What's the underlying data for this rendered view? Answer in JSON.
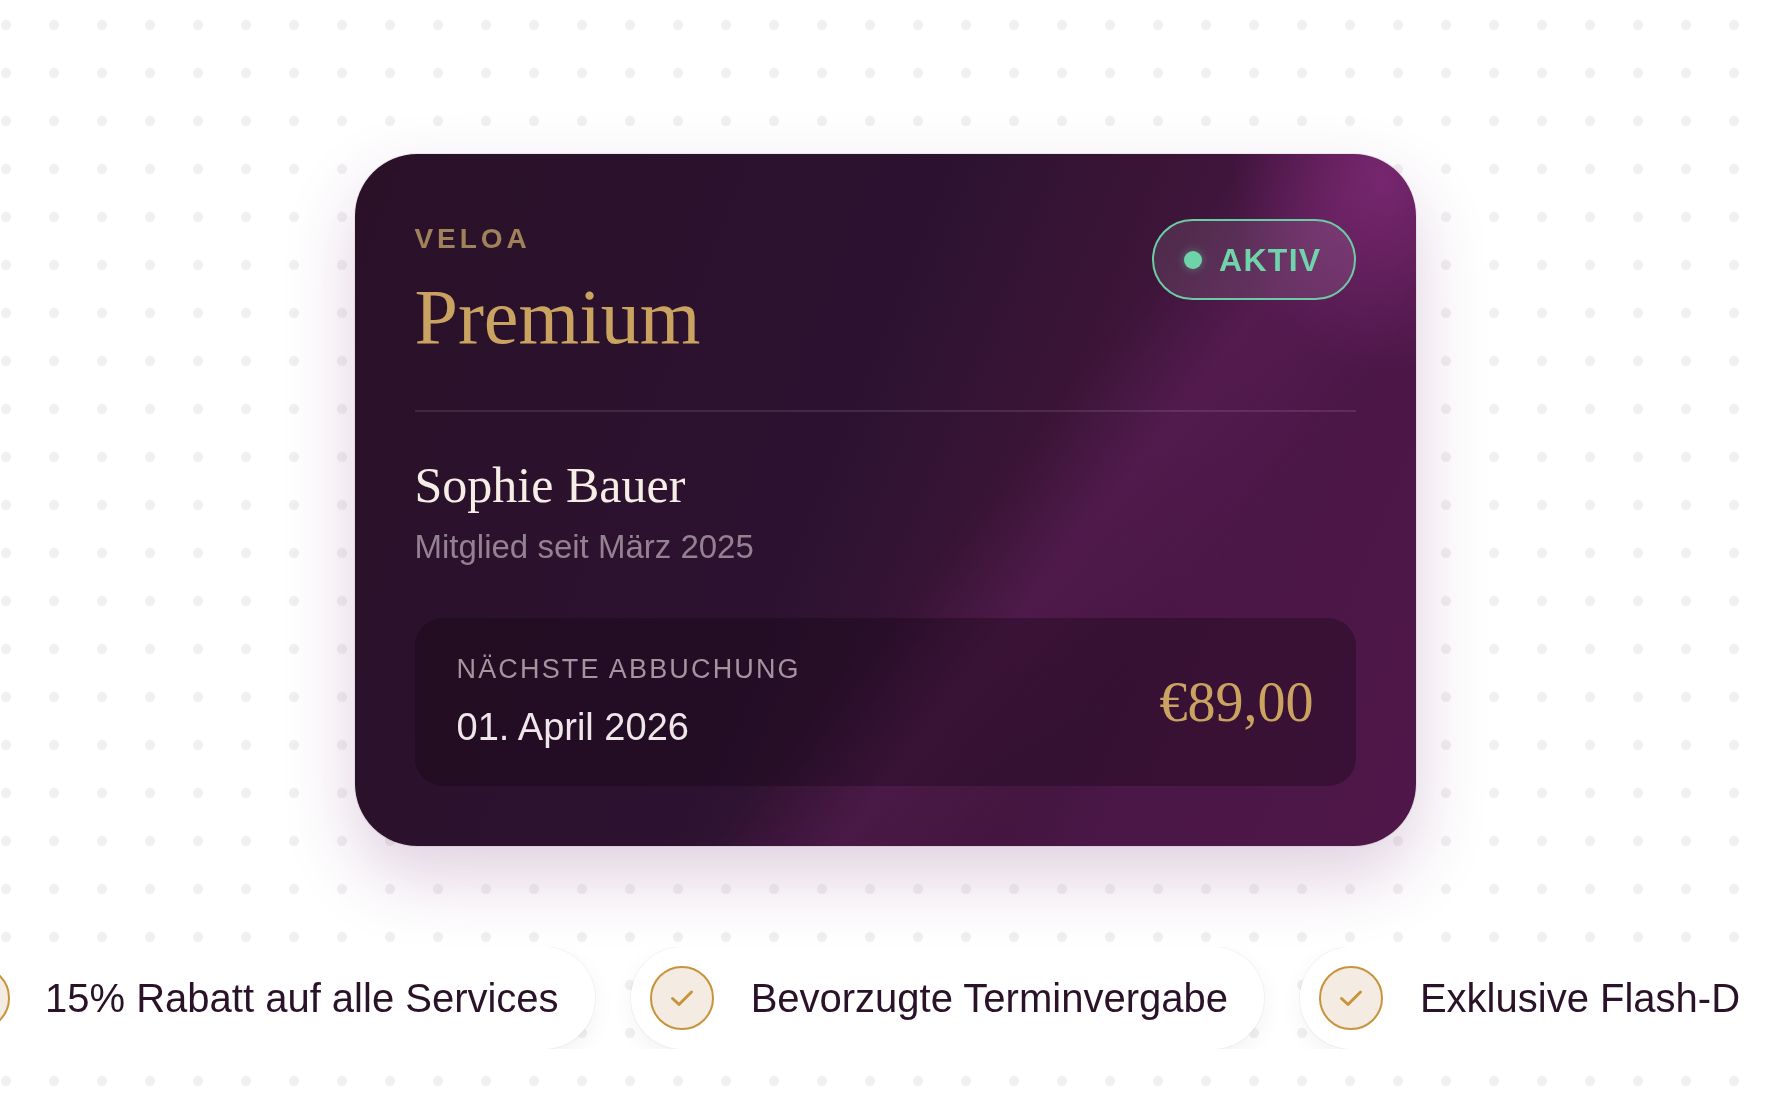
{
  "card": {
    "brand": "VELOA",
    "plan": "Premium",
    "status": "AKTIV",
    "member": {
      "name": "Sophie Bauer",
      "since": "Mitglied seit März 2025"
    },
    "billing": {
      "label": "NÄCHSTE ABBUCHUNG",
      "date": "01. April 2026",
      "amount": "€89,00"
    }
  },
  "benefits": [
    {
      "text": "15% Rabatt auf alle Services"
    },
    {
      "text": "Bevorzugte Terminvergabe"
    },
    {
      "text": "Exklusive Flash-D"
    }
  ]
}
